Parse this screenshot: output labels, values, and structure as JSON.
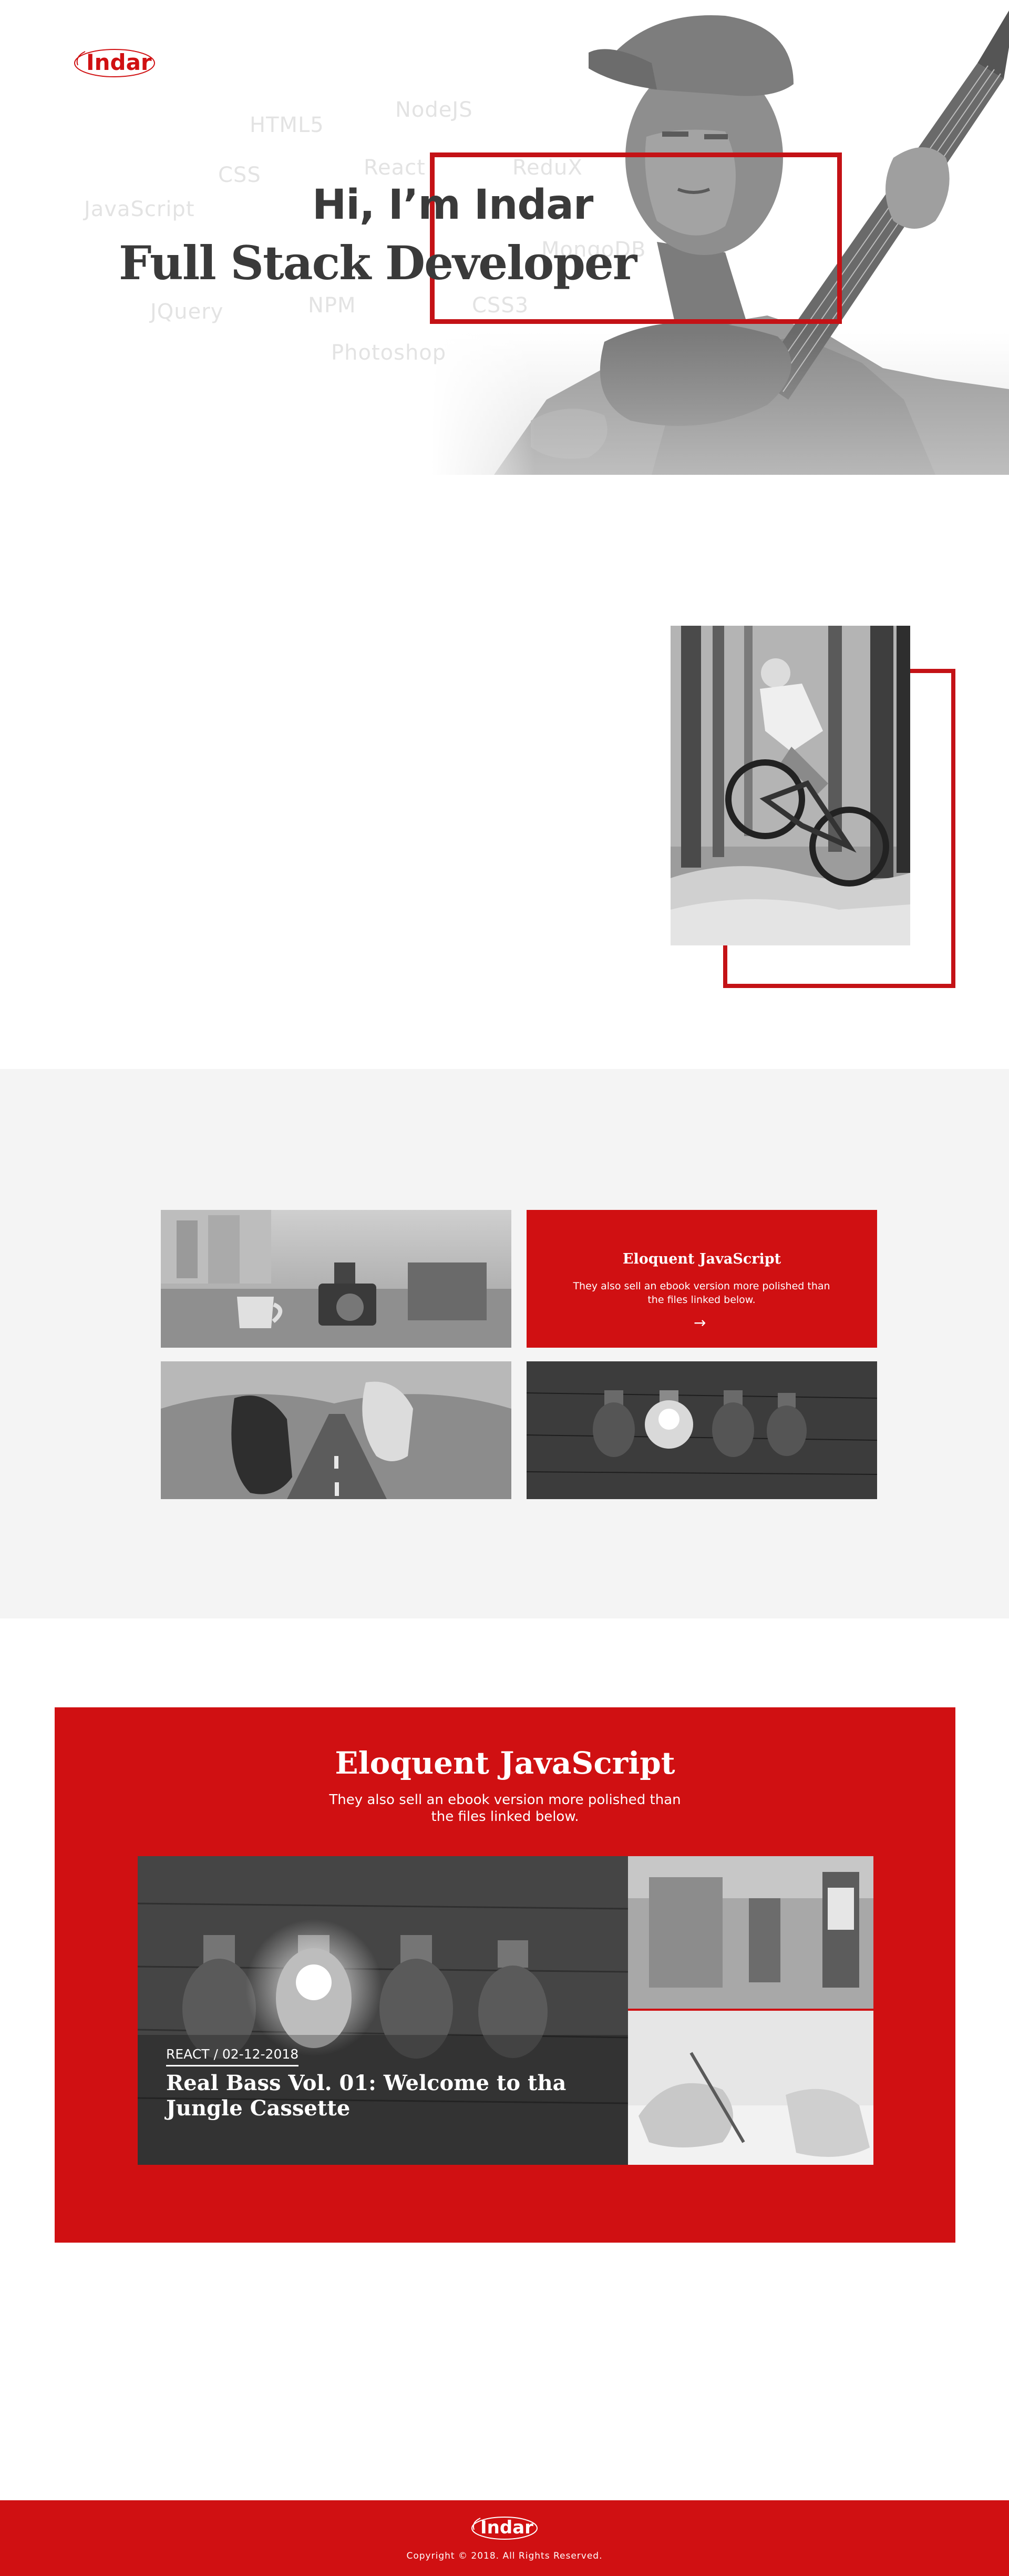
{
  "brand": {
    "logo_text": "Indar",
    "accent_color": "#d01012"
  },
  "hero": {
    "greeting": "Hi, I’m Indar",
    "role": "Full Stack Developer",
    "skills": [
      "HTML5",
      "NodeJS",
      "CSS",
      "React",
      "ReduX",
      "JavaScript",
      "MongoDB",
      "JQuery",
      "NPM",
      "CSS3",
      "Photoshop"
    ]
  },
  "about": {
    "photo": "mountain-biker-photo"
  },
  "grid": {
    "card": {
      "title": "Eloquent JavaScript",
      "description": "They also sell an ebook version more polished than the files linked below.",
      "arrow": "→"
    },
    "tiles": [
      "coffee-camera-photo",
      "sneakers-road-photo",
      "light-bulbs-photo"
    ]
  },
  "feature": {
    "title": "Eloquent JavaScript",
    "description": "They also sell an ebook version more polished than the files linked below.",
    "post": {
      "meta": "REACT / 02-12-2018",
      "title": "Real Bass Vol. 01: Welcome to tha Jungle Cassette"
    }
  },
  "footer": {
    "logo_text": "Indar",
    "copyright": "Copyright © 2018. All Rights Reserved."
  }
}
